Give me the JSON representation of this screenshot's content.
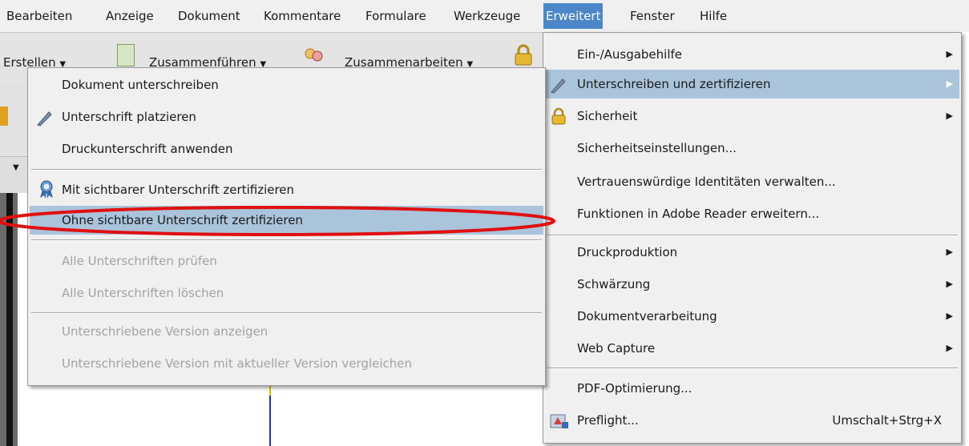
{
  "menubar": {
    "items": [
      "Bearbeiten",
      "Anzeige",
      "Dokument",
      "Kommentare",
      "Formulare",
      "Werkzeuge",
      "Erweitert",
      "Fenster",
      "Hilfe"
    ],
    "active": "Erweitert"
  },
  "toolbar": {
    "create": "Erstellen",
    "merge": "Zusammenführen",
    "collaborate": "Zusammenarbeiten"
  },
  "erweitert_menu": {
    "items": [
      {
        "label": "Ein-/Ausgabehilfe",
        "submenu": true
      },
      {
        "label": "Unterschreiben und zertifizieren",
        "submenu": true,
        "highlighted": true,
        "icon": "pen-icon"
      },
      {
        "label": "Sicherheit",
        "submenu": true,
        "icon": "lock-icon"
      },
      {
        "label": "Sicherheitseinstellungen..."
      },
      {
        "label": "Vertrauenswürdige Identitäten verwalten..."
      },
      {
        "label": "Funktionen in Adobe Reader erweitern..."
      },
      {
        "label": "Druckproduktion",
        "submenu": true
      },
      {
        "label": "Schwärzung",
        "submenu": true
      },
      {
        "label": "Dokumentverarbeitung",
        "submenu": true
      },
      {
        "label": "Web Capture",
        "submenu": true
      },
      {
        "label": "PDF-Optimierung..."
      },
      {
        "label": "Preflight...",
        "shortcut": "Umschalt+Strg+X",
        "icon": "preflight-icon"
      }
    ]
  },
  "sign_menu": {
    "items": [
      {
        "label": "Dokument unterschreiben"
      },
      {
        "label": "Unterschrift platzieren",
        "icon": "pen-icon"
      },
      {
        "label": "Druckunterschrift anwenden"
      },
      {
        "label": "Mit sichtbarer Unterschrift zertifizieren",
        "icon": "certificate-ribbon-icon"
      },
      {
        "label": "Ohne sichtbare Unterschrift zertifizieren",
        "highlighted": true
      },
      {
        "label": "Alle Unterschriften prüfen",
        "disabled": true
      },
      {
        "label": "Alle Unterschriften löschen",
        "disabled": true
      },
      {
        "label": "Unterschriebene Version anzeigen",
        "disabled": true
      },
      {
        "label": "Unterschriebene Version mit aktueller Version vergleichen",
        "disabled": true
      }
    ]
  },
  "colors": {
    "menu_bg": "#f0f0f0",
    "highlight": "#aac4db",
    "active_menu": "#4a86c8",
    "disabled_text": "#a3a3a3",
    "annotation_red": "#e01010"
  }
}
